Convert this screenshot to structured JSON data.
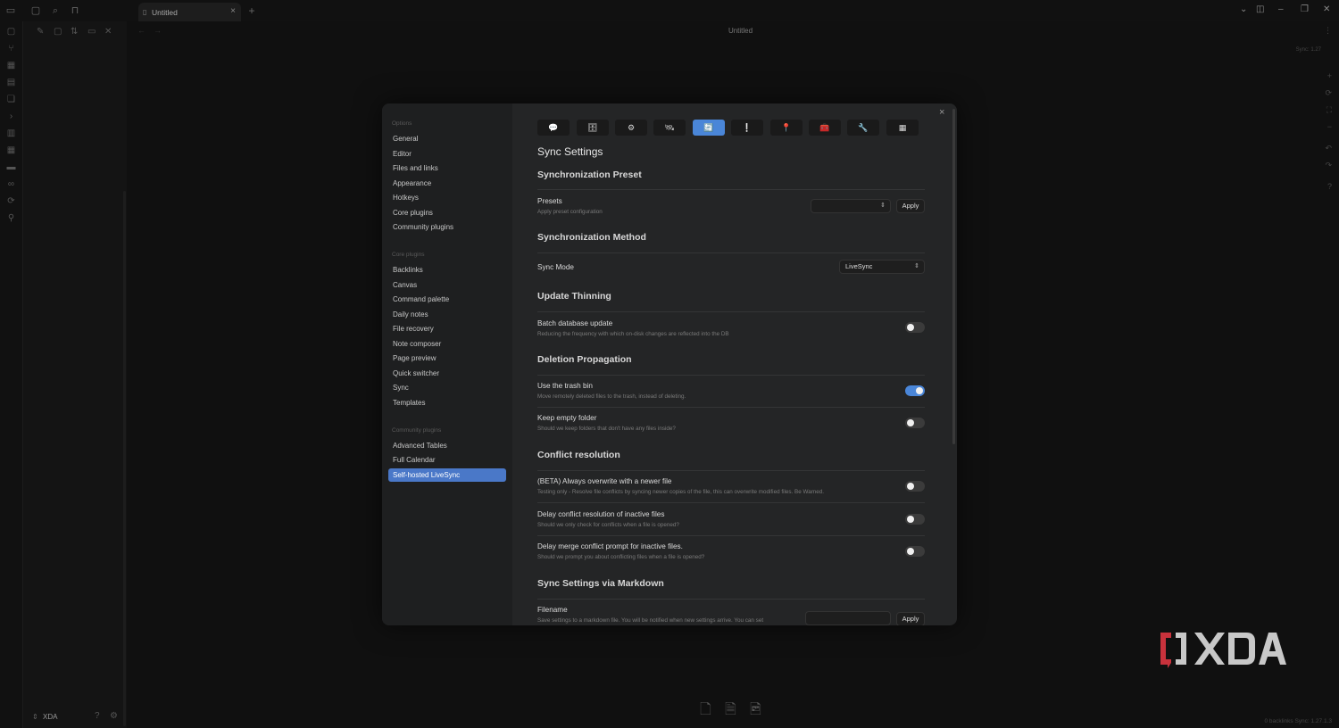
{
  "titlebar": {
    "tab_label": "Untitled",
    "new_tab_symbol": "+",
    "close_symbol": "×"
  },
  "main": {
    "document_title": "Untitled",
    "sync_indicator": "Sync: 1.27",
    "statusbar": "0 backlinks  Sync: 1.27.1.3"
  },
  "vault": {
    "name": "XDA"
  },
  "settings": {
    "sections": {
      "options": "Options",
      "core_plugins": "Core plugins",
      "community_plugins": "Community plugins"
    },
    "options_items": [
      "General",
      "Editor",
      "Files and links",
      "Appearance",
      "Hotkeys",
      "Core plugins",
      "Community plugins"
    ],
    "core_items": [
      "Backlinks",
      "Canvas",
      "Command palette",
      "Daily notes",
      "File recovery",
      "Note composer",
      "Page preview",
      "Quick switcher",
      "Sync",
      "Templates"
    ],
    "community_items": [
      "Advanced Tables",
      "Full Calendar",
      "Self-hosted LiveSync"
    ],
    "active_item": "Self-hosted LiveSync",
    "close_symbol": "×"
  },
  "tabs": {
    "icons": [
      "speech-bubble-icon",
      "server-icon",
      "gear-icon",
      "satellite-icon",
      "sync-icon",
      "warning-icon",
      "pin-icon",
      "toolbox-icon",
      "wrench-icon",
      "table-icon"
    ],
    "glyphs": [
      "💬",
      "🗄",
      "⚙",
      "🛰",
      "🔄",
      "❕",
      "📍",
      "🧰",
      "🔧",
      "▦"
    ],
    "active_index": 4
  },
  "sync": {
    "title": "Sync Settings",
    "preset": {
      "heading": "Synchronization Preset",
      "name": "Presets",
      "desc": "Apply preset configuration",
      "value": "",
      "button": "Apply"
    },
    "method": {
      "heading": "Synchronization Method",
      "name": "Sync Mode",
      "value": "LiveSync"
    },
    "thinning": {
      "heading": "Update Thinning",
      "name": "Batch database update",
      "desc": "Reducing the frequency with which on-disk changes are reflected into the DB"
    },
    "deletion": {
      "heading": "Deletion Propagation",
      "trash_name": "Use the trash bin",
      "trash_desc": "Move remotely deleted files to the trash, instead of deleting.",
      "empty_name": "Keep empty folder",
      "empty_desc": "Should we keep folders that don't have any files inside?"
    },
    "conflict": {
      "heading": "Conflict resolution",
      "overwrite_name": "(BETA) Always overwrite with a newer file",
      "overwrite_desc": "Testing only - Resolve file conflicts by syncing newer copies of the file, this can overwrite modified files. Be Warned.",
      "delay_name": "Delay conflict resolution of inactive files",
      "delay_desc": "Should we only check for conflicts when a file is opened?",
      "merge_name": "Delay merge conflict prompt for inactive files.",
      "merge_desc": "Should we prompt you about conflicting files when a file is opened?"
    },
    "markdown": {
      "heading": "Sync Settings via Markdown",
      "name": "Filename",
      "desc": "Save settings to a markdown file. You will be notified when new settings arrive. You can set",
      "button": "Apply"
    }
  },
  "toggles": {
    "batch_update": false,
    "trash_bin": true,
    "keep_empty_folder": false,
    "always_overwrite": false,
    "delay_conflict": false,
    "delay_merge": false
  },
  "colors": {
    "accent": "#4a86d8",
    "sidebar_active": "#4a78c8",
    "modal_bg": "#242526",
    "xda_red": "#c8323c"
  },
  "xda": {
    "logo_text": "XDA"
  }
}
